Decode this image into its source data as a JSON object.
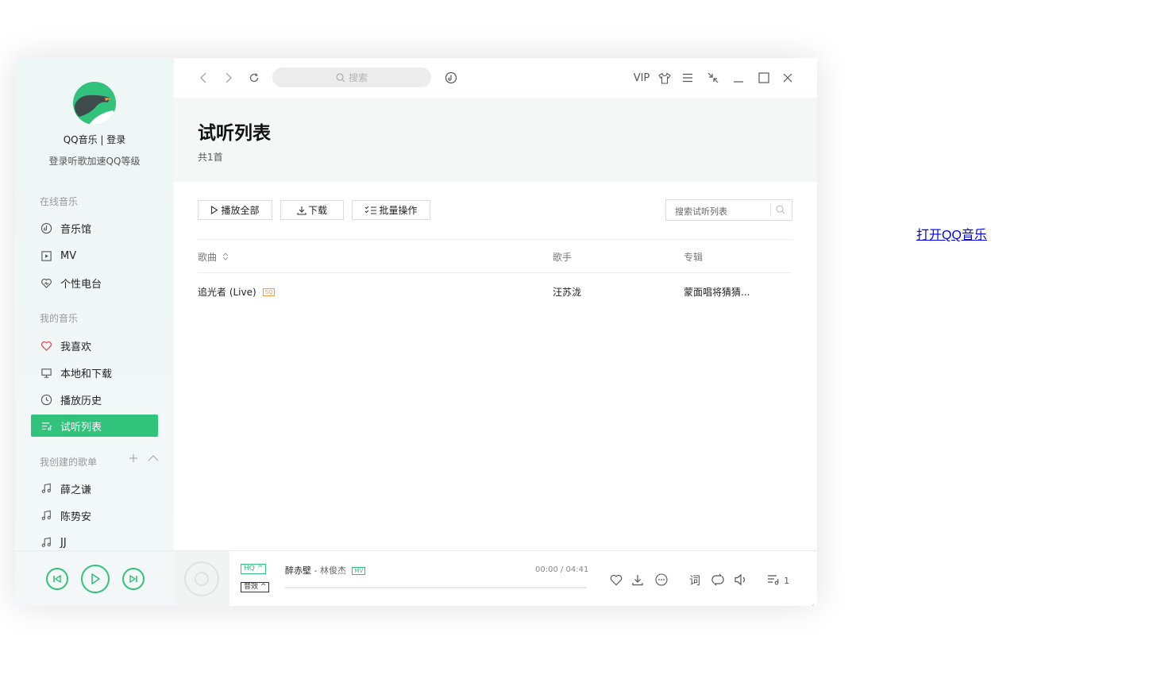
{
  "sidebar": {
    "user_name": "QQ音乐 | 登录",
    "user_sub": "登录听歌加速QQ等级",
    "sections": {
      "online": "在线音乐",
      "mine": "我的音乐",
      "created": "我创建的歌单"
    },
    "online_items": [
      {
        "label": "音乐馆",
        "icon": "music-hall-icon"
      },
      {
        "label": "MV",
        "icon": "mv-icon"
      },
      {
        "label": "个性电台",
        "icon": "radio-icon"
      }
    ],
    "my_items": [
      {
        "label": "我喜欢",
        "icon": "heart-icon"
      },
      {
        "label": "本地和下载",
        "icon": "computer-icon"
      },
      {
        "label": "播放历史",
        "icon": "clock-icon"
      },
      {
        "label": "试听列表",
        "icon": "playlist-icon",
        "active": true
      }
    ],
    "playlists": [
      {
        "label": "薛之谦"
      },
      {
        "label": "陈势安"
      },
      {
        "label": "JJ"
      }
    ]
  },
  "topbar": {
    "search_placeholder": "搜索",
    "vip_label": "VIP"
  },
  "header": {
    "title": "试听列表",
    "count": "共1首"
  },
  "toolbar": {
    "play_all": "播放全部",
    "download": "下载",
    "batch": "批量操作",
    "search_placeholder": "搜索试听列表"
  },
  "table": {
    "columns": [
      "歌曲",
      "歌手",
      "专辑"
    ],
    "rows": [
      {
        "song": "追光者 (Live)",
        "badge": "SQ",
        "artist": "汪苏泷",
        "album": "蒙面唱将猜猜..."
      }
    ]
  },
  "player": {
    "quality": "HQ",
    "effect": "音效",
    "song": "醉赤壁",
    "artist": "林俊杰",
    "mv_badge": "MV",
    "time": "00:00 / 04:41",
    "lyric_label": "词",
    "queue_count": "1"
  },
  "colors": {
    "accent": "#31c27c",
    "sq_badge": "#f39b3a"
  },
  "external_link": "打开QQ音乐"
}
